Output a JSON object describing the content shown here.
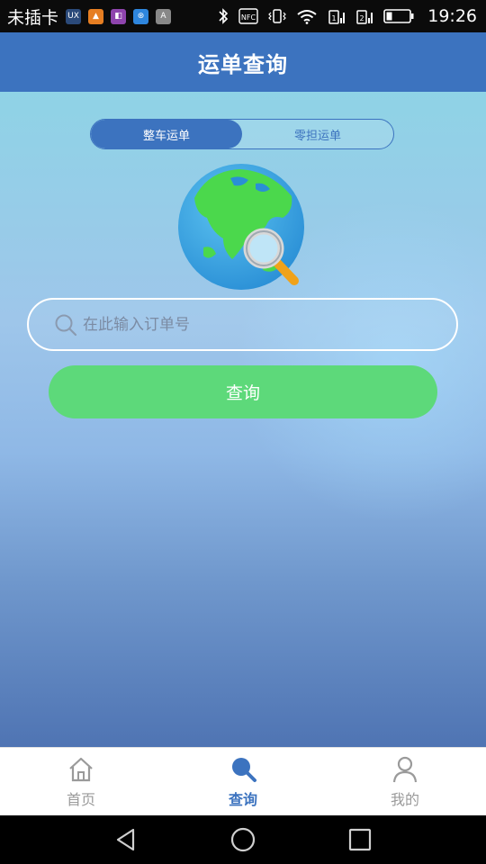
{
  "status_bar": {
    "carrier": "未插卡",
    "time": "19:26",
    "app_icons": [
      {
        "name": "ux-app-icon",
        "glyph": "UX",
        "color": "#2b4a7a"
      },
      {
        "name": "orange-app-icon",
        "glyph": "▲",
        "color": "#e67e22"
      },
      {
        "name": "purple-app-icon",
        "glyph": "◧",
        "color": "#8e44ad"
      },
      {
        "name": "blue-app-icon",
        "glyph": "⊛",
        "color": "#2e86de"
      },
      {
        "name": "gray-app-icon",
        "glyph": "A",
        "color": "#888888"
      }
    ],
    "nfc_label": "NFC"
  },
  "header": {
    "title": "运单查询"
  },
  "segment": {
    "options": [
      {
        "label": "整车运单",
        "active": true
      },
      {
        "label": "零担运单",
        "active": false
      }
    ]
  },
  "search": {
    "placeholder": "在此输入订单号",
    "value": ""
  },
  "query_button": {
    "label": "查询"
  },
  "tabbar": {
    "items": [
      {
        "label": "首页",
        "icon": "home-icon",
        "active": false
      },
      {
        "label": "查询",
        "icon": "search-icon",
        "active": true
      },
      {
        "label": "我的",
        "icon": "user-icon",
        "active": false
      }
    ]
  },
  "colors": {
    "primary": "#3c73bf",
    "button_green": "#5dd97a"
  }
}
